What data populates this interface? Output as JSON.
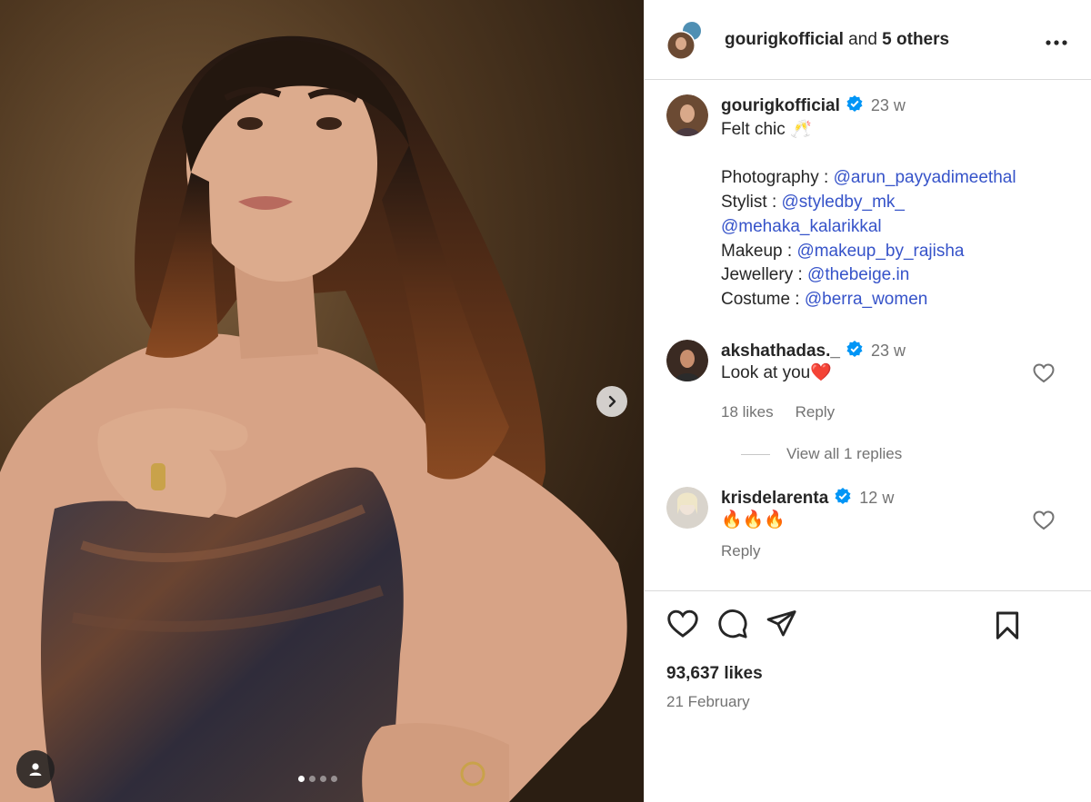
{
  "header": {
    "username": "gourigkofficial",
    "collab_text": " and ",
    "others": "5 others"
  },
  "caption": {
    "username": "gourigkofficial",
    "time": "23 w",
    "lines": [
      {
        "prefix": "Felt chic ",
        "mention": "",
        "emoji": "🥂"
      },
      {
        "prefix": "",
        "mention": "",
        "emoji": ""
      },
      {
        "prefix": "Photography : ",
        "mention": "@arun_payyadimeethal",
        "emoji": ""
      },
      {
        "prefix": "Stylist : ",
        "mention": "@styledby_mk_",
        "emoji": ""
      },
      {
        "prefix": "",
        "mention": "@mehaka_kalarikkal",
        "emoji": ""
      },
      {
        "prefix": "Makeup : ",
        "mention": "@makeup_by_rajisha",
        "emoji": ""
      },
      {
        "prefix": "Jewellery : ",
        "mention": "@thebeige.in",
        "emoji": ""
      },
      {
        "prefix": "Costume : ",
        "mention": "@berra_women",
        "emoji": ""
      }
    ]
  },
  "comments": [
    {
      "username": "akshathadas._",
      "time": "23 w",
      "text": "Look at you",
      "emoji": "❤️",
      "likes": "18 likes",
      "reply": "Reply",
      "view_replies": "View all 1 replies"
    },
    {
      "username": "krisdelarenta",
      "time": "12 w",
      "text": "",
      "emoji": "🔥🔥🔥",
      "likes": "",
      "reply": "Reply"
    }
  ],
  "footer": {
    "likes": "93,637 likes",
    "date": "21 February"
  },
  "icons": [
    "heart-icon",
    "comment-icon",
    "share-icon",
    "bookmark-icon",
    "chevron-right-icon",
    "user-tag-icon",
    "more-icon",
    "verified-icon"
  ],
  "colors": {
    "link": "#3653c9",
    "verified": "#0095f6",
    "muted": "#737373"
  }
}
